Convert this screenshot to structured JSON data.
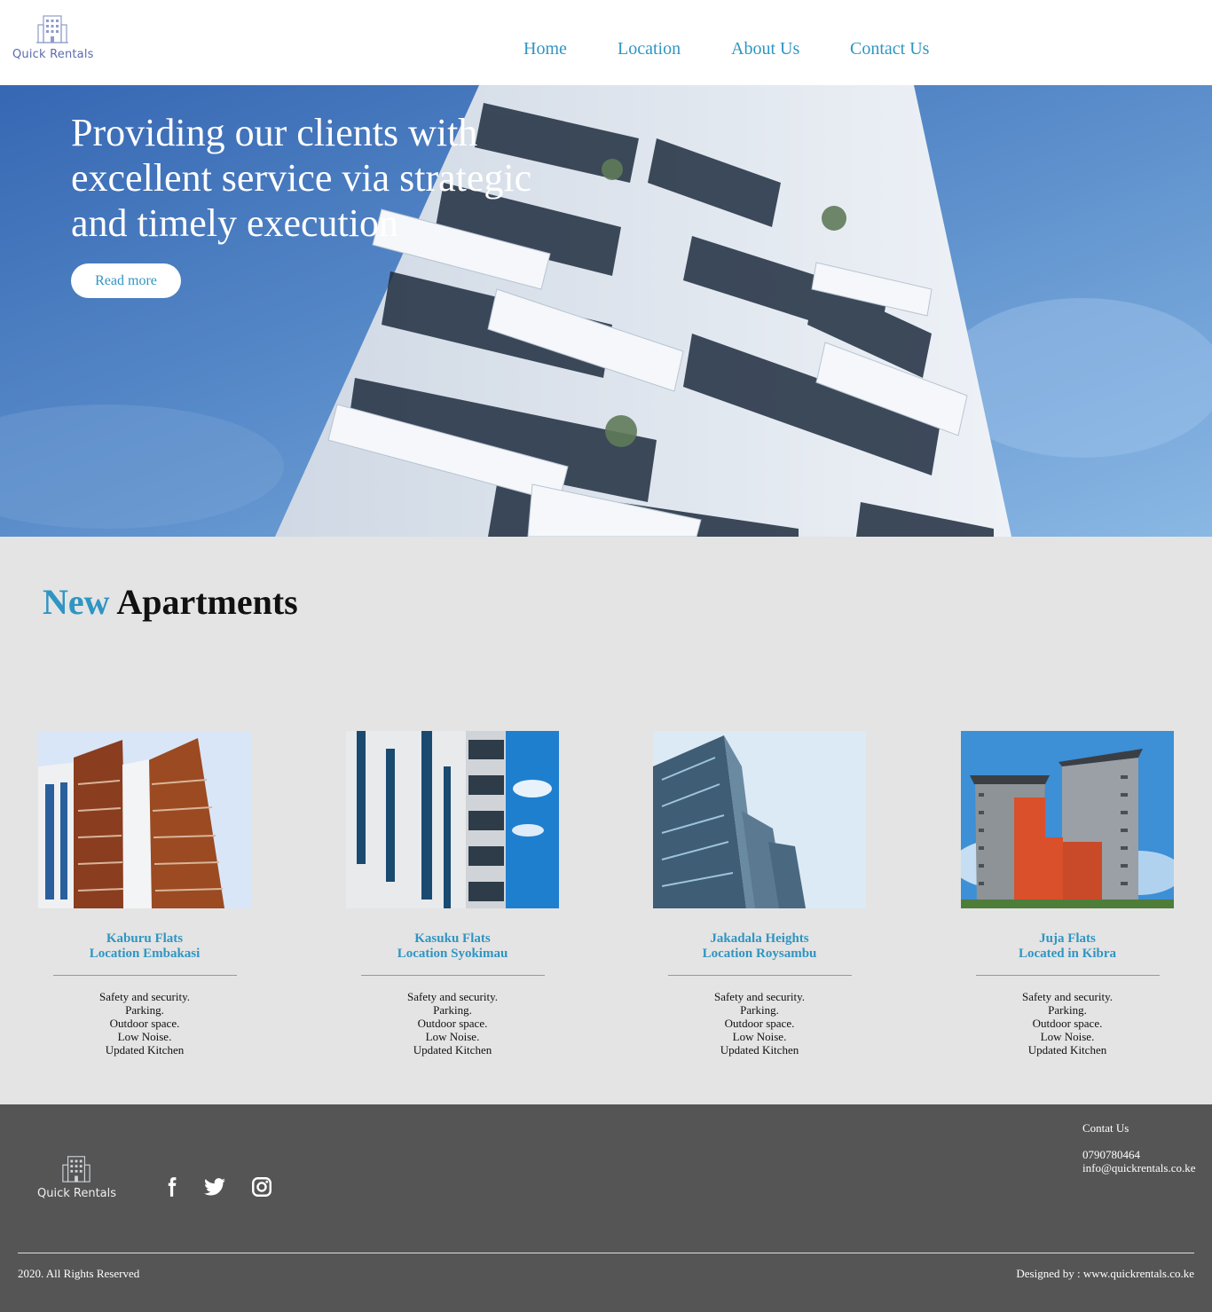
{
  "header": {
    "logo_text": "Quick Rentals",
    "nav": [
      {
        "label": "Home"
      },
      {
        "label": "Location"
      },
      {
        "label": "About Us"
      },
      {
        "label": "Contact Us"
      }
    ]
  },
  "hero": {
    "heading": "Providing our clients with excellent service via strategic and timely execution",
    "button_label": "Read more"
  },
  "apartments": {
    "title_accent": "New",
    "title_rest": "Apartments",
    "cards": [
      {
        "name": "Kaburu Flats",
        "location": "Location Embakasi",
        "features": [
          "Safety and security.",
          "Parking.",
          "Outdoor space.",
          "Low Noise.",
          "Updated Kitchen"
        ]
      },
      {
        "name": "Kasuku Flats",
        "location": "Location Syokimau",
        "features": [
          "Safety and security.",
          "Parking.",
          "Outdoor space.",
          "Low Noise.",
          "Updated Kitchen"
        ]
      },
      {
        "name": "Jakadala Heights",
        "location": "Location Roysambu",
        "features": [
          "Safety and security.",
          "Parking.",
          "Outdoor space.",
          "Low Noise.",
          "Updated Kitchen"
        ]
      },
      {
        "name": "Juja Flats",
        "location": "Located in Kibra",
        "features": [
          "Safety and security.",
          "Parking.",
          "Outdoor space.",
          "Low Noise.",
          "Updated Kitchen"
        ]
      }
    ]
  },
  "footer": {
    "logo_text": "Quick Rentals",
    "social": [
      "facebook-icon",
      "twitter-icon",
      "instagram-icon"
    ],
    "contact_title": "Contat Us",
    "phone": "0790780464",
    "email": "info@quickrentals.co.ke",
    "copyright": "2020. All Rights Reserved",
    "designed_by": "Designed by : www.quickrentals.co.ke"
  },
  "colors": {
    "accent": "#2f95c2",
    "section_bg": "#e4e4e4",
    "footer_bg": "#555555"
  }
}
